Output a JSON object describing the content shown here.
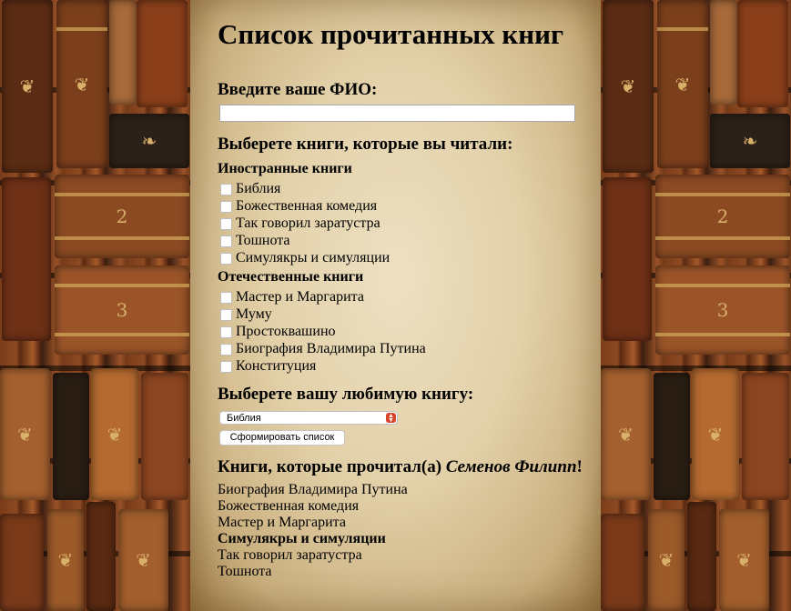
{
  "page": {
    "title": "Список прочитанных книг"
  },
  "form": {
    "fio_label": "Введите ваше ФИО:",
    "fio_value": "",
    "books_label": "Выберете книги, которые вы читали:",
    "groups": [
      {
        "title": "Иностранные книги",
        "items": [
          {
            "label": "Библия",
            "checked": false
          },
          {
            "label": "Божественная комедия",
            "checked": false
          },
          {
            "label": "Так говорил заратустра",
            "checked": false
          },
          {
            "label": "Тошнота",
            "checked": false
          },
          {
            "label": "Симулякры и симуляции",
            "checked": false
          }
        ]
      },
      {
        "title": "Отечественные книги",
        "items": [
          {
            "label": "Мастер и Маргарита",
            "checked": false
          },
          {
            "label": "Муму",
            "checked": false
          },
          {
            "label": "Простоквашино",
            "checked": false
          },
          {
            "label": "Биография Владимира Путина",
            "checked": false
          },
          {
            "label": "Конституция",
            "checked": false
          }
        ]
      }
    ],
    "favorite_label": "Выберете вашу любимую книгу:",
    "favorite_selected": "Библия",
    "submit_label": "Сформировать список"
  },
  "result": {
    "title_prefix": "Книги, которые прочитал(а) ",
    "reader_name": "Семенов Филипп",
    "title_suffix": "!",
    "books": [
      {
        "label": "Биография Владимира Путина",
        "favorite": false
      },
      {
        "label": "Божественная комедия",
        "favorite": false
      },
      {
        "label": "Мастер и Маргарита",
        "favorite": false
      },
      {
        "label": "Симулякры и симуляции",
        "favorite": true
      },
      {
        "label": "Так говорил заратустра",
        "favorite": false
      },
      {
        "label": "Тошнота",
        "favorite": false
      }
    ]
  },
  "colors": {
    "parchment": "#e2d0a8",
    "leather": "#7a3c1a",
    "gold": "#d8b06a",
    "select_arrow": "#d8452c"
  },
  "icons": {
    "select_arrow": "updown-chevron-icon"
  }
}
